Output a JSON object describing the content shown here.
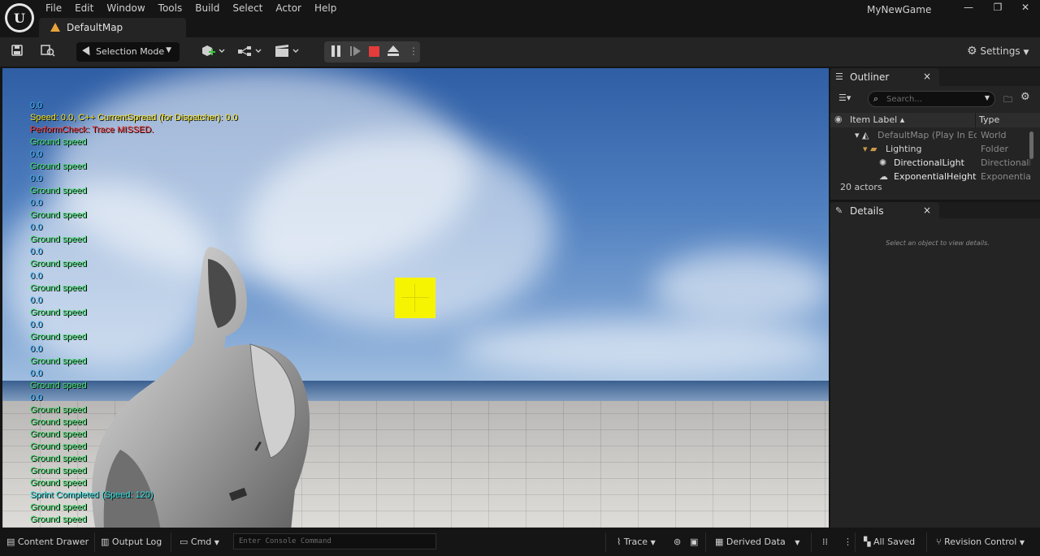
{
  "window": {
    "project_name": "MyNewGame",
    "menu": [
      "File",
      "Edit",
      "Window",
      "Tools",
      "Build",
      "Select",
      "Actor",
      "Help"
    ],
    "map_tab": "DefaultMap"
  },
  "toolbar": {
    "selection_mode": "Selection Mode",
    "settings": "Settings"
  },
  "viewport": {
    "debug_log": [
      {
        "text": "0.0",
        "color": "#38b6ff"
      },
      {
        "text": "Speed: 0.0, C++ CurrentSpread (for Dispatcher): 0.0",
        "color": "#f5e21c"
      },
      {
        "text": "PerformCheck: Trace MISSED.",
        "color": "#ff3a3a"
      },
      {
        "text": "Ground speed",
        "color": "#3fe06a"
      },
      {
        "text": "0.0",
        "color": "#38b6ff"
      },
      {
        "text": "Ground speed",
        "color": "#3fe06a"
      },
      {
        "text": "0.0",
        "color": "#38b6ff"
      },
      {
        "text": "Ground speed",
        "color": "#3fe06a"
      },
      {
        "text": "0.0",
        "color": "#38b6ff"
      },
      {
        "text": "Ground speed",
        "color": "#3fe06a"
      },
      {
        "text": "0.0",
        "color": "#38b6ff"
      },
      {
        "text": "Ground speed",
        "color": "#3fe06a"
      },
      {
        "text": "0.0",
        "color": "#38b6ff"
      },
      {
        "text": "Ground speed",
        "color": "#3fe06a"
      },
      {
        "text": "0.0",
        "color": "#38b6ff"
      },
      {
        "text": "Ground speed",
        "color": "#3fe06a"
      },
      {
        "text": "0.0",
        "color": "#38b6ff"
      },
      {
        "text": "Ground speed",
        "color": "#3fe06a"
      },
      {
        "text": "0.0",
        "color": "#38b6ff"
      },
      {
        "text": "Ground speed",
        "color": "#3fe06a"
      },
      {
        "text": "0.0",
        "color": "#38b6ff"
      },
      {
        "text": "Ground speed",
        "color": "#3fe06a"
      },
      {
        "text": "0.0",
        "color": "#38b6ff"
      },
      {
        "text": "Ground speed",
        "color": "#3fe06a"
      },
      {
        "text": "0.0",
        "color": "#38b6ff"
      },
      {
        "text": "Ground speed",
        "color": "#3fe06a"
      },
      {
        "text": "Ground speed",
        "color": "#3fe06a"
      },
      {
        "text": "Ground speed",
        "color": "#3fe06a"
      },
      {
        "text": "Ground speed",
        "color": "#3fe06a"
      },
      {
        "text": "Ground speed",
        "color": "#3fe06a"
      },
      {
        "text": "Ground speed",
        "color": "#3fe06a"
      },
      {
        "text": "Ground speed",
        "color": "#3fe06a"
      },
      {
        "text": "Sprint Completed (Speed: 120)",
        "color": "#2ee0e0"
      },
      {
        "text": "Ground speed",
        "color": "#3fe06a"
      },
      {
        "text": "Ground speed",
        "color": "#3fe06a"
      }
    ],
    "crosshair_color": "#f6f400"
  },
  "outliner": {
    "tab": "Outliner",
    "search_placeholder": "Search...",
    "col_label": "Item Label ▴",
    "col_type": "Type",
    "rows": [
      {
        "name": "DefaultMap (Play In Editor)",
        "type": "World",
        "icon": "world-icon",
        "name_color": "#8a8a8a"
      },
      {
        "name": "Lighting",
        "type": "Folder",
        "icon": "folder-icon",
        "name_color": "#d6d6d6"
      },
      {
        "name": "DirectionalLight",
        "type": "DirectionalL",
        "icon": "directional-light-icon",
        "name_color": "#e8e8e8"
      },
      {
        "name": "ExponentialHeightFog",
        "type": "Exponential",
        "icon": "fog-icon",
        "name_color": "#e8e8e8"
      }
    ],
    "actor_count": "20 actors"
  },
  "details": {
    "tab": "Details",
    "hint": "Select an object to view details."
  },
  "statusbar": {
    "content_drawer": "Content Drawer",
    "output_log": "Output Log",
    "cmd": "Cmd",
    "console_placeholder": "Enter Console Command",
    "trace": "Trace",
    "derived_data": "Derived Data",
    "all_saved": "All Saved",
    "revision_control": "Revision Control"
  }
}
